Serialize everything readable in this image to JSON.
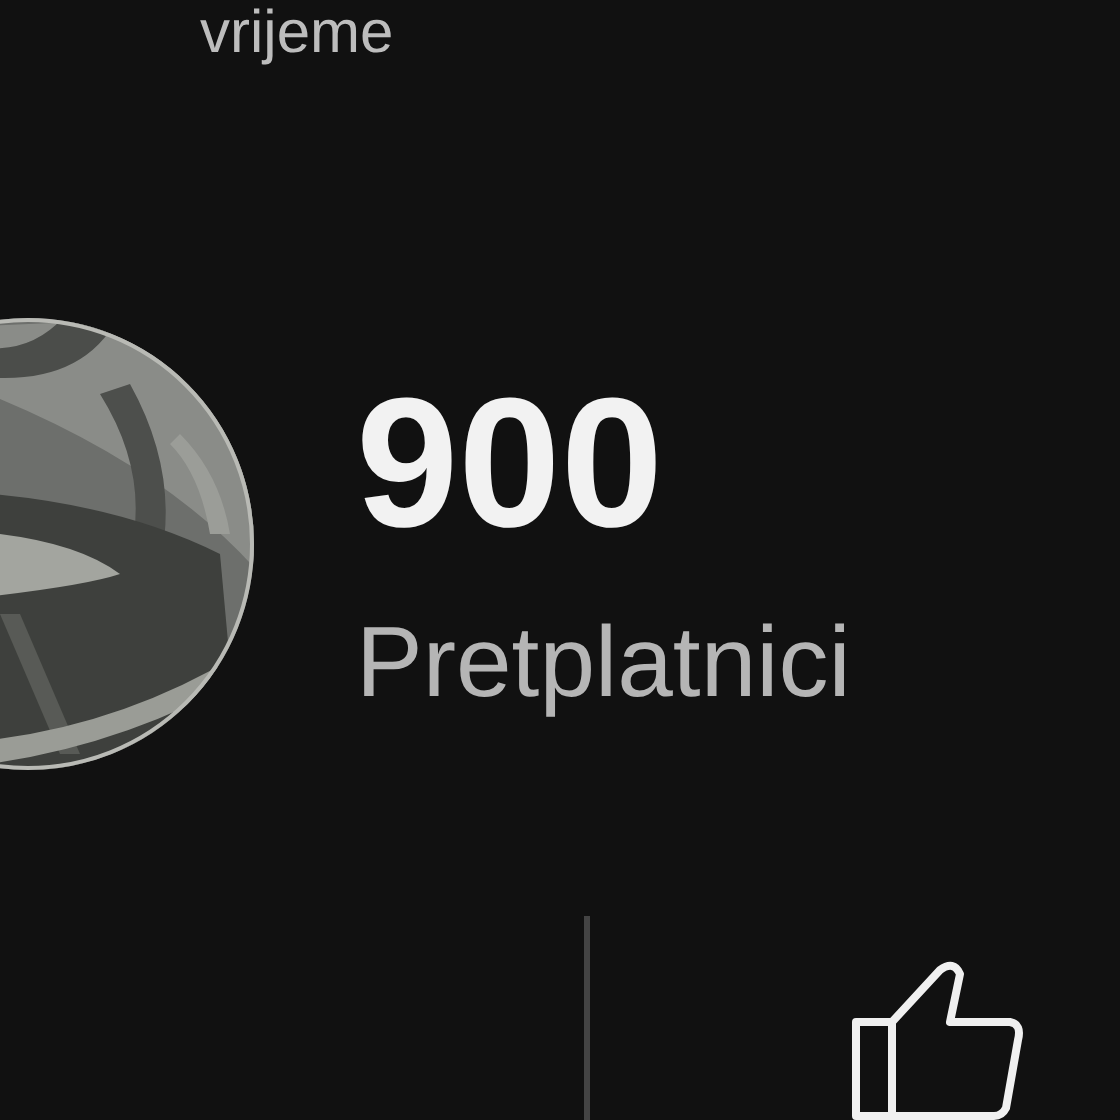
{
  "title": "vrijeme",
  "stats": {
    "count": "900",
    "label": "Pretplatnici"
  }
}
